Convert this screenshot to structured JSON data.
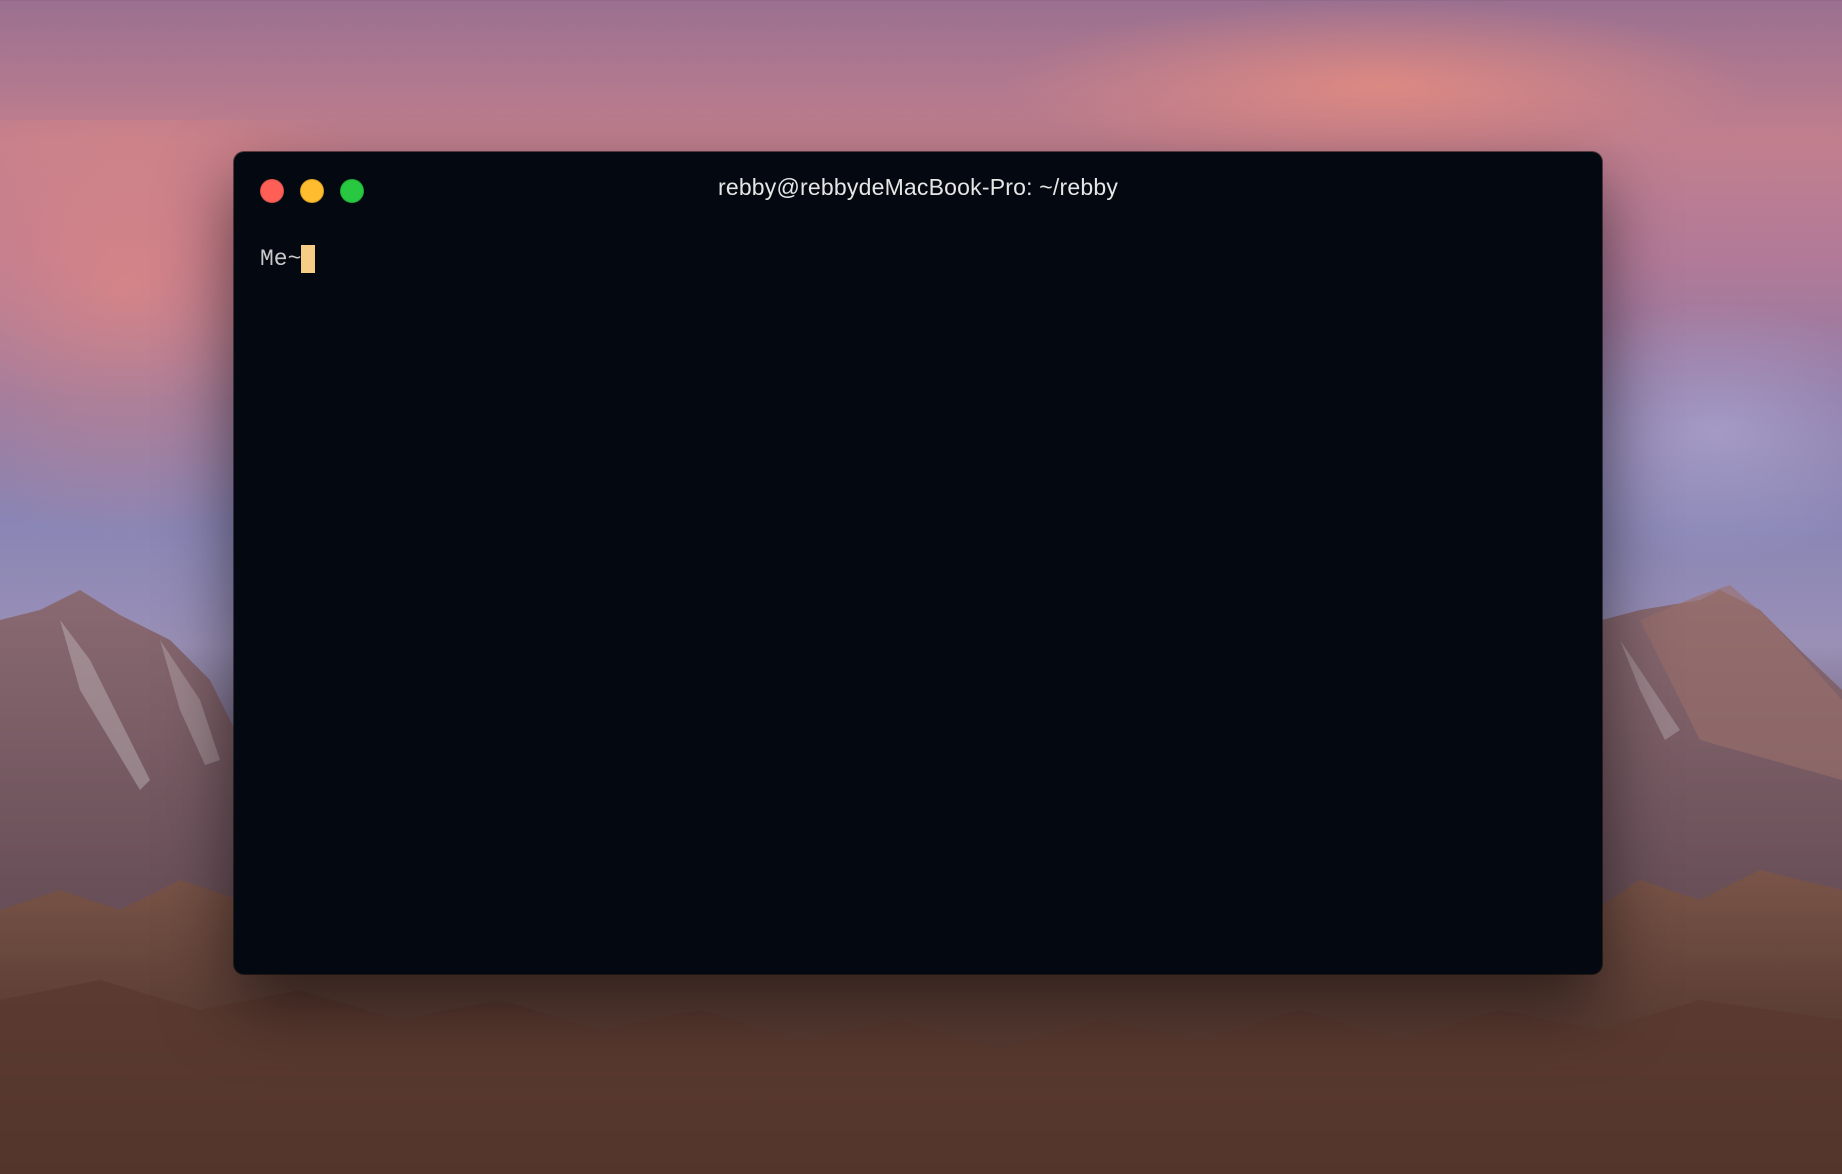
{
  "window": {
    "title": "rebby@rebbydeMacBook-Pro: ~/rebby"
  },
  "terminal": {
    "prompt": "Me~",
    "cursor_color": "#f5cd84",
    "background_color": "#030811"
  },
  "controls": {
    "close_color": "#fe5f57",
    "minimize_color": "#febc2e",
    "maximize_color": "#28c840"
  }
}
